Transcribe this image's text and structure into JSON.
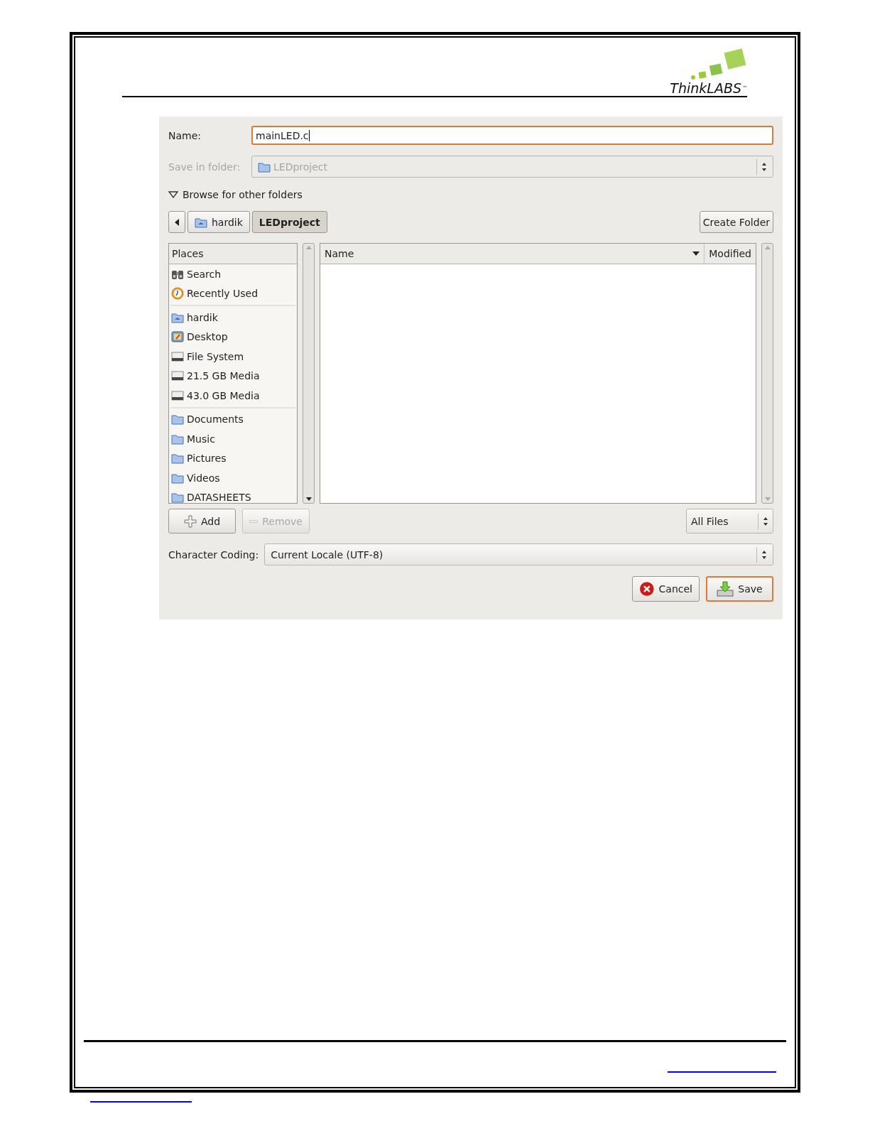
{
  "logo": {
    "name": "ThinkLABS",
    "trademark": "™"
  },
  "dialog": {
    "name_field": {
      "label": "Name:",
      "value": "mainLED.c",
      "focused": true
    },
    "save_in_folder": {
      "label": "Save in folder:",
      "value": "LEDproject",
      "disabled": true
    },
    "browse_expander": {
      "label": "Browse for other folders",
      "expanded": true
    },
    "path_bar": [
      {
        "label": "hardik",
        "kind": "home",
        "selected": false
      },
      {
        "label": "LEDproject",
        "kind": "plain",
        "selected": true
      }
    ],
    "create_folder_button": "Create Folder",
    "places": {
      "header": "Places",
      "groups": [
        [
          {
            "label": "Search",
            "kind": "search"
          },
          {
            "label": "Recently Used",
            "kind": "recent"
          }
        ],
        [
          {
            "label": "hardik",
            "kind": "home"
          },
          {
            "label": "Desktop",
            "kind": "desktop"
          },
          {
            "label": "File System",
            "kind": "drive"
          },
          {
            "label": "21.5 GB Media",
            "kind": "drive"
          },
          {
            "label": "43.0 GB Media",
            "kind": "drive"
          }
        ],
        [
          {
            "label": "Documents",
            "kind": "folder"
          },
          {
            "label": "Music",
            "kind": "folder"
          },
          {
            "label": "Pictures",
            "kind": "folder"
          },
          {
            "label": "Videos",
            "kind": "folder"
          },
          {
            "label": "DATASHEETS",
            "kind": "folder"
          }
        ]
      ]
    },
    "file_list": {
      "columns": [
        {
          "label": "Name",
          "sorted": true
        },
        {
          "label": "Modified",
          "sorted": false
        }
      ]
    },
    "add_button": {
      "label": "Add",
      "disabled": false
    },
    "remove_button": {
      "label": "Remove",
      "disabled": true
    },
    "filter": "All Files",
    "character_coding": {
      "label": "Character Coding:",
      "value": "Current Locale (UTF-8)"
    },
    "buttons": [
      {
        "label": "Cancel",
        "kind": "cancel",
        "default": false
      },
      {
        "label": "Save",
        "kind": "save",
        "default": true
      }
    ]
  }
}
